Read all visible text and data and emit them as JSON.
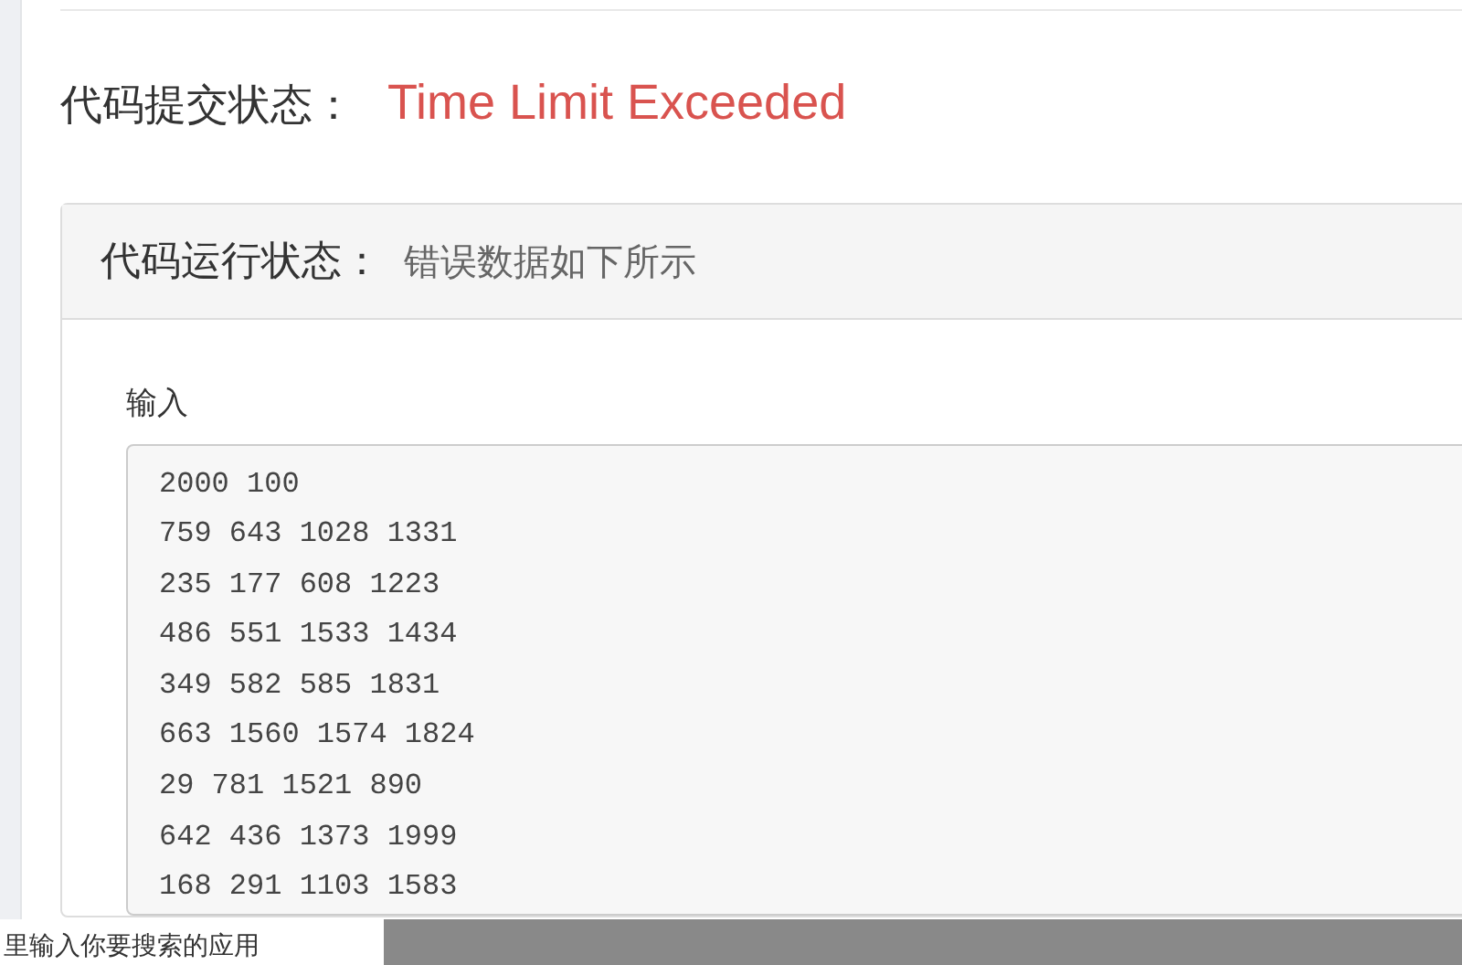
{
  "submission": {
    "label": "代码提交状态：",
    "status": "Time Limit Exceeded",
    "kind": "error"
  },
  "panel": {
    "title": "代码运行状态：",
    "subtitle": "错误数据如下所示",
    "input_label": "输入",
    "input_lines": [
      "2000 100",
      "759 643 1028 1331",
      "235 177 608 1223",
      "486 551 1533 1434",
      "349 582 585 1831",
      "663 1560 1574 1824",
      "29 781 1521 890",
      "642 436 1373 1999",
      "168 291 1103 1583"
    ]
  },
  "taskbar": {
    "search_placeholder": "里输入你要搜索的应用"
  }
}
